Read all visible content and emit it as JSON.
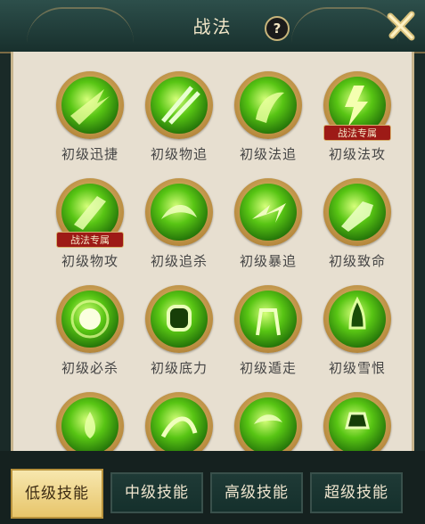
{
  "header": {
    "title": "战法",
    "help": "?"
  },
  "skills": [
    {
      "name": "初级迅捷",
      "badge": ""
    },
    {
      "name": "初级物追",
      "badge": ""
    },
    {
      "name": "初级法追",
      "badge": ""
    },
    {
      "name": "初级法攻",
      "badge": "战法专属"
    },
    {
      "name": "初级物攻",
      "badge": "战法专属"
    },
    {
      "name": "初级追杀",
      "badge": ""
    },
    {
      "name": "初级暴追",
      "badge": ""
    },
    {
      "name": "初级致命",
      "badge": ""
    },
    {
      "name": "初级必杀",
      "badge": ""
    },
    {
      "name": "初级底力",
      "badge": ""
    },
    {
      "name": "初级遁走",
      "badge": ""
    },
    {
      "name": "初级雪恨",
      "badge": ""
    },
    {
      "name": "",
      "badge": ""
    },
    {
      "name": "",
      "badge": ""
    },
    {
      "name": "",
      "badge": ""
    },
    {
      "name": "",
      "badge": ""
    }
  ],
  "tabs": [
    {
      "label": "低级技能",
      "active": true
    },
    {
      "label": "中级技能",
      "active": false
    },
    {
      "label": "高级技能",
      "active": false
    },
    {
      "label": "超级技能",
      "active": false
    }
  ],
  "icons": {
    "close": "close-icon",
    "help": "help-icon"
  }
}
